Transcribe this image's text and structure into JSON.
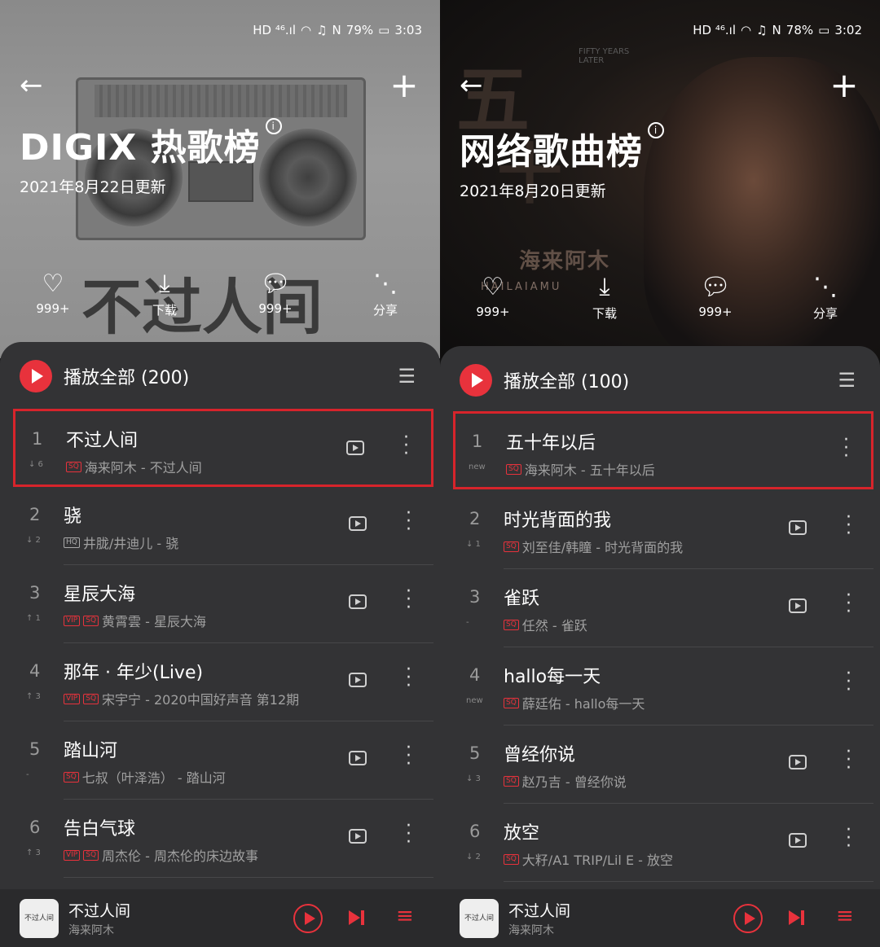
{
  "left": {
    "status": {
      "signal": "HD ⁴⁶.ıl",
      "battery": "79%",
      "time": "3:03"
    },
    "title": "DIGIX 热歌榜",
    "updated": "2021年8月22日更新",
    "art_text": "不过人间",
    "actions": {
      "like": "999+",
      "download": "下载",
      "comment": "999+",
      "share": "分享"
    },
    "play_all": "播放全部 (200)",
    "songs": [
      {
        "rank": "1",
        "trend": "↓ 6",
        "title": "不过人间",
        "badges": [
          "SQ"
        ],
        "meta": "海来阿木 - 不过人间",
        "video": true
      },
      {
        "rank": "2",
        "trend": "↓ 2",
        "title": "骁",
        "badges": [
          "HQ"
        ],
        "meta": "井胧/井迪儿 - 骁",
        "video": true
      },
      {
        "rank": "3",
        "trend": "↑ 1",
        "title": "星辰大海",
        "badges": [
          "VIP",
          "SQ"
        ],
        "meta": "黄霄雲 - 星辰大海",
        "video": true
      },
      {
        "rank": "4",
        "trend": "↑ 3",
        "title": "那年 · 年少(Live)",
        "badges": [
          "VIP",
          "SQ"
        ],
        "meta": "宋宇宁 - 2020中国好声音 第12期",
        "video": true
      },
      {
        "rank": "5",
        "trend": "-",
        "title": "踏山河",
        "badges": [
          "SQ"
        ],
        "meta": "七叔（叶泽浩） - 踏山河",
        "video": true
      },
      {
        "rank": "6",
        "trend": "↑ 3",
        "title": "告白气球",
        "badges": [
          "VIP",
          "SQ"
        ],
        "meta": "周杰伦 - 周杰伦的床边故事",
        "video": true
      }
    ],
    "mini": {
      "title": "不过人间",
      "artist": "海来阿木",
      "cover": "不过人间"
    }
  },
  "right": {
    "status": {
      "signal": "HD ⁴⁶.ıl",
      "battery": "78%",
      "time": "3:02"
    },
    "title": "网络歌曲榜",
    "updated": "2021年8月20日更新",
    "art_text": "海来阿木",
    "art_sub": "HAILAIAMU",
    "art_corner": "FIFTY YEARS LATER",
    "actions": {
      "like": "999+",
      "download": "下载",
      "comment": "999+",
      "share": "分享"
    },
    "play_all": "播放全部 (100)",
    "songs": [
      {
        "rank": "1",
        "trend": "new",
        "title": "五十年以后",
        "badges": [
          "SQ"
        ],
        "meta": "海来阿木 - 五十年以后",
        "video": false
      },
      {
        "rank": "2",
        "trend": "↓ 1",
        "title": "时光背面的我",
        "badges": [
          "SQ"
        ],
        "meta": "刘至佳/韩瞳 - 时光背面的我",
        "video": true
      },
      {
        "rank": "3",
        "trend": "-",
        "title": "雀跃",
        "badges": [
          "SQ"
        ],
        "meta": "任然 - 雀跃",
        "video": true
      },
      {
        "rank": "4",
        "trend": "new",
        "title": "hallo每一天",
        "badges": [
          "SQ"
        ],
        "meta": "薛廷佑 - hallo每一天",
        "video": false
      },
      {
        "rank": "5",
        "trend": "↓ 3",
        "title": "曾经你说",
        "badges": [
          "SQ"
        ],
        "meta": "赵乃吉 - 曾经你说",
        "video": true
      },
      {
        "rank": "6",
        "trend": "↓ 2",
        "title": "放空",
        "badges": [
          "SQ"
        ],
        "meta": "大籽/A1 TRIP/Lil E - 放空",
        "video": true
      }
    ],
    "mini": {
      "title": "不过人间",
      "artist": "海来阿木",
      "cover": "不过人间"
    }
  },
  "colors": {
    "accent": "#e8323c",
    "highlight_border": "#d7242b",
    "card_bg": "#333335"
  }
}
